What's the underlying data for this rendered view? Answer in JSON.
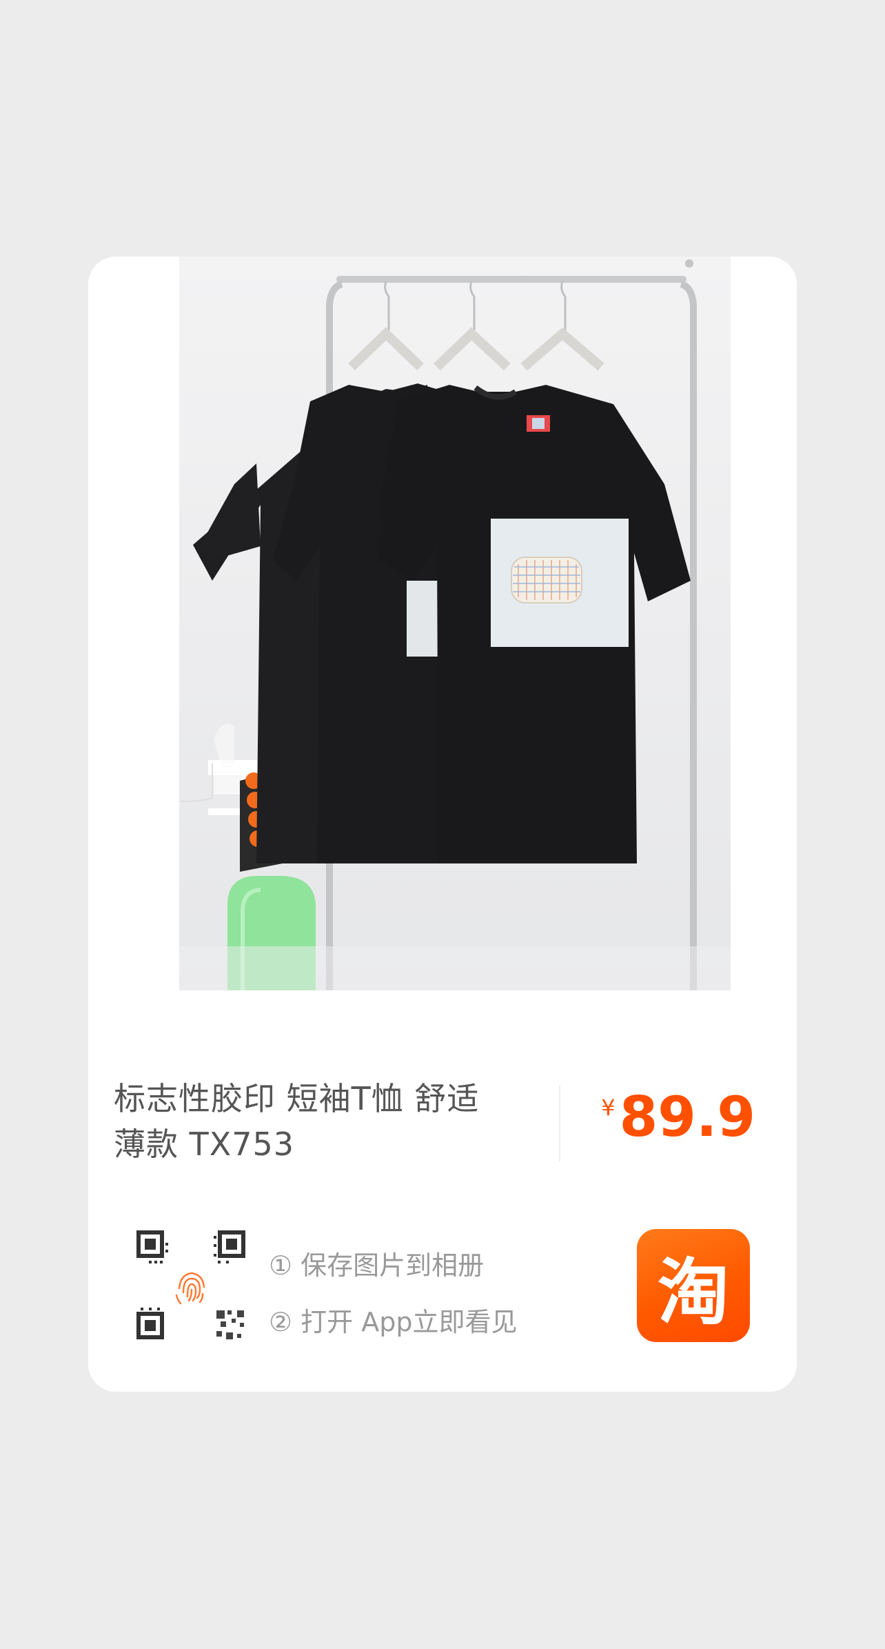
{
  "product": {
    "title_line1": "标志性胶印 短袖T恤 舒适",
    "title_line2": "薄款 TX753"
  },
  "price": {
    "currency": "¥",
    "amount": "89.9",
    "color": "#ff5000"
  },
  "instructions": {
    "step1": "① 保存图片到相册",
    "step2": "② 打开 App立即看见"
  },
  "icons": {
    "qr": "qr-code-fingerprint-icon",
    "logo": "taobao-logo"
  },
  "logo": {
    "char": "淘",
    "brand_color": "#ff5a00"
  }
}
